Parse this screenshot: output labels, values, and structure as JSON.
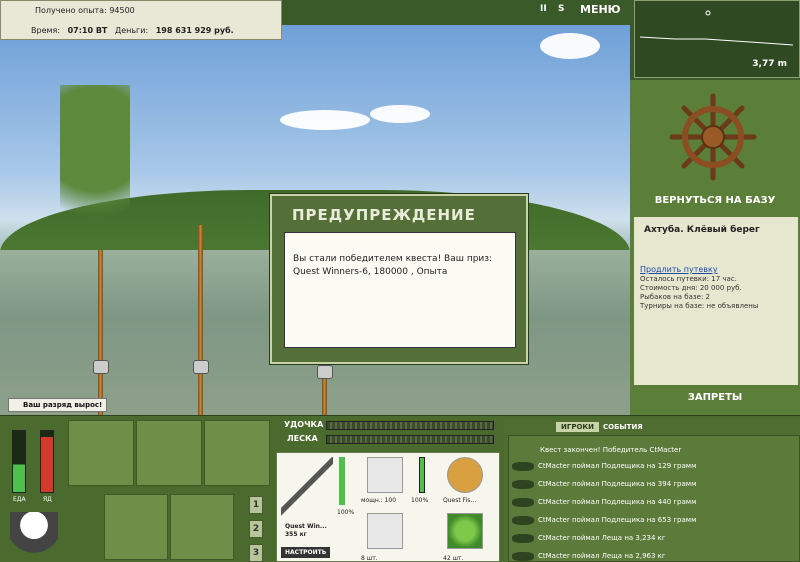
{
  "header": {
    "exp_line": "Получено опыта: 94500",
    "time_label": "Время:",
    "time_value": "07:10 ВТ",
    "money_label": "Деньги:",
    "money_value": "198 631 929 руб.",
    "menu_label": "МЕНЮ",
    "pause_glyph": "II",
    "sound_glyph": "S"
  },
  "depth": {
    "value": "3,77 m"
  },
  "right_panel": {
    "back_button": "ВЕРНУТЬСЯ НА БАЗУ",
    "location": "Ахтуба. Клёвый берег",
    "extend_link": "Продлить путевку",
    "remaining": "Осталось путевки: 17 час.",
    "day_cost": "Стоимость дня: 20 000 руб.",
    "fishers": "Рыбаков на базе: 2",
    "tournaments": "Турниры на базе: не объявлены",
    "bans_button": "ЗАПРЕТЫ"
  },
  "dialog": {
    "title": "ПРЕДУПРЕЖДЕНИЕ",
    "text_1": "Вы стали победителем квеста! Ваш приз:",
    "text_2": "Quest Winners-6, 180000 , Опыта"
  },
  "rank_notice": "Ваш разряд вырос!",
  "meters": {
    "food_label": "ЕДА",
    "poison_label": "ЯД",
    "food_level": 0.45,
    "poison_level": 0.9
  },
  "slots": {
    "numbers": [
      "1",
      "2",
      "3"
    ]
  },
  "tackle": {
    "rod_label": "УДОЧКА",
    "line_label": "ЛЕСКА",
    "rod_name": "Quest Win...",
    "rod_weight": "355 кг",
    "rod_percent": "100%",
    "reel_power": "мощн.: 100",
    "reel_percent": "100%",
    "bait_name": "Quest Fis...",
    "hook_count": "8 шт.",
    "bait_count": "42 шт.",
    "setup_button": "НАСТРОИТЬ"
  },
  "events": {
    "tab_players": "ИГРОКИ",
    "tab_events": "СОБЫТИЯ",
    "header": "Квест закончен! Победитель CtMacter",
    "items": [
      "CtMacter поймал Подлещика на 129 грамм",
      "CtMacter поймал Подлещика на 394 грамм",
      "CtMacter поймал Подлещика на 440 грамм",
      "CtMacter поймал Подлещика на 653 грамм",
      "CtMacter поймал Леща на 3,234 кг",
      "CtMacter поймал Леща на 2,963 кг"
    ]
  },
  "colors": {
    "panel_green": "#5b7e38",
    "dark_green": "#3b5a2a",
    "cream": "#e7e7cf",
    "link_blue": "#1b4aa8"
  }
}
